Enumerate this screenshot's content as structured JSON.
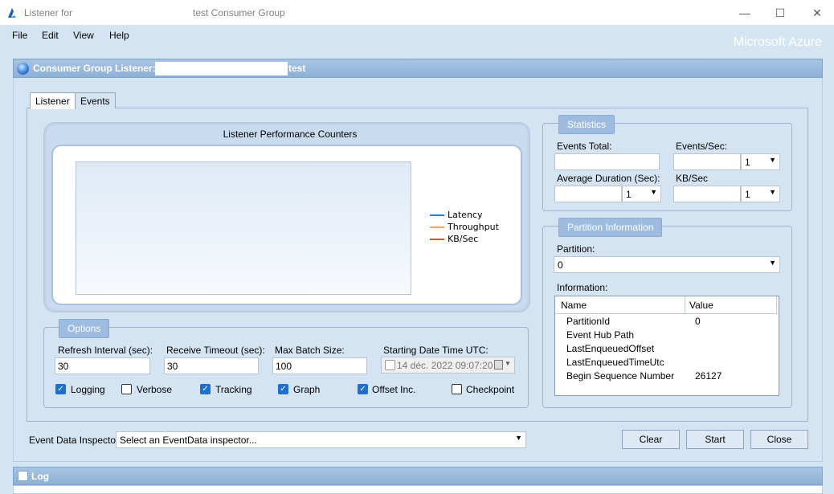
{
  "window": {
    "title_left": "Listener for",
    "title_right": "test Consumer Group",
    "minimize": "—",
    "maximize": "☐",
    "close": "✕"
  },
  "menu": {
    "file": "File",
    "edit": "Edit",
    "view": "View",
    "help": "Help"
  },
  "brand": "Microsoft Azure",
  "panel": {
    "title": "Consumer Group Listener:",
    "suffix": "test"
  },
  "tabs": {
    "listener": "Listener",
    "events": "Events"
  },
  "chart": {
    "title": "Listener Performance Counters",
    "legend": [
      {
        "label": "Latency",
        "color": "#2f7fd8"
      },
      {
        "label": "Throughput",
        "color": "#f0a83a"
      },
      {
        "label": "KB/Sec",
        "color": "#d9541e"
      }
    ]
  },
  "statistics": {
    "title": "Statistics",
    "events_total_label": "Events Total:",
    "events_sec_label": "Events/Sec:",
    "avg_duration_label": "Average Duration (Sec):",
    "kb_sec_label": "KB/Sec",
    "events_sec_select": "1",
    "avg_duration_select": "1",
    "kb_sec_select": "1"
  },
  "partition": {
    "title": "Partition Information",
    "partition_label": "Partition:",
    "partition_value": "0",
    "information_label": "Information:",
    "columns": {
      "name": "Name",
      "value": "Value"
    },
    "rows": [
      {
        "name": "PartitionId",
        "value": "0"
      },
      {
        "name": "Event Hub Path",
        "value": ""
      },
      {
        "name": "LastEnqueuedOffset",
        "value": ""
      },
      {
        "name": "LastEnqueuedTimeUtc",
        "value": ""
      },
      {
        "name": "Begin Sequence Number",
        "value": "26127"
      }
    ]
  },
  "options": {
    "title": "Options",
    "refresh_label": "Refresh Interval (sec):",
    "refresh_value": "30",
    "receive_label": "Receive Timeout (sec):",
    "receive_value": "30",
    "batch_label": "Max Batch Size:",
    "batch_value": "100",
    "start_label": "Starting Date Time UTC:",
    "start_value": "14 déc. 2022 09:07:20",
    "logging": "Logging",
    "verbose": "Verbose",
    "tracking": "Tracking",
    "graph": "Graph",
    "offset": "Offset Inc.",
    "checkpoint": "Checkpoint"
  },
  "inspector": {
    "label": "Event Data Inspector:",
    "value": "Select an EventData inspector..."
  },
  "buttons": {
    "clear": "Clear",
    "start": "Start",
    "close": "Close"
  },
  "log": {
    "title": "Log"
  }
}
